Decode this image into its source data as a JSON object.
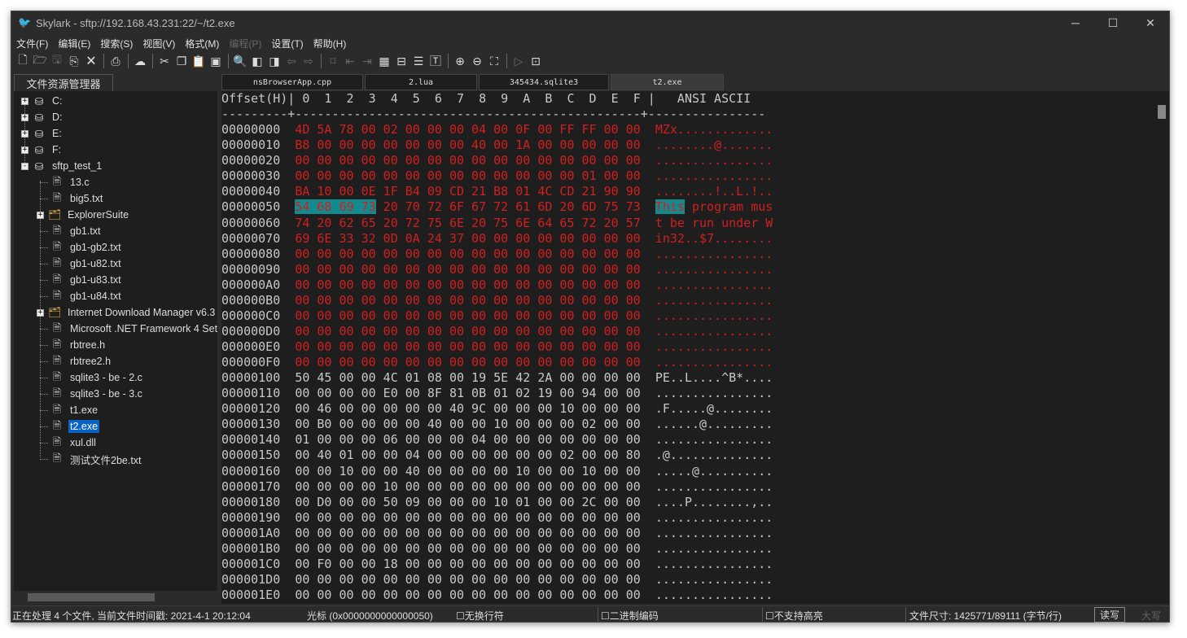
{
  "window": {
    "title": "Skylark - sftp://192.168.43.231:22/~/t2.exe",
    "minimize": "─",
    "maximize": "☐",
    "close": "✕"
  },
  "menu": [
    {
      "label": "文件(F)",
      "enabled": true
    },
    {
      "label": "编辑(E)",
      "enabled": true
    },
    {
      "label": "搜索(S)",
      "enabled": true
    },
    {
      "label": "视图(V)",
      "enabled": true
    },
    {
      "label": "格式(M)",
      "enabled": true
    },
    {
      "label": "编程(P)",
      "enabled": false
    },
    {
      "label": "设置(T)",
      "enabled": true
    },
    {
      "label": "帮助(H)",
      "enabled": true
    }
  ],
  "toolbar": [
    {
      "icon": "new-file-icon",
      "glyph": "🗋",
      "enabled": true
    },
    {
      "icon": "open-folder-icon",
      "glyph": "🗁",
      "enabled": true
    },
    {
      "icon": "save-icon",
      "glyph": "🖫",
      "enabled": false
    },
    {
      "icon": "save-all-icon",
      "glyph": "⎘",
      "enabled": true
    },
    {
      "icon": "close-file-icon",
      "glyph": "🗙",
      "enabled": true
    },
    {
      "sep": true
    },
    {
      "icon": "print-icon",
      "glyph": "⎙",
      "enabled": true
    },
    {
      "sep": true
    },
    {
      "icon": "remote-cloud-icon",
      "glyph": "☁",
      "enabled": true
    },
    {
      "sep": true
    },
    {
      "icon": "cut-icon",
      "glyph": "✂",
      "enabled": true
    },
    {
      "icon": "copy-icon",
      "glyph": "❐",
      "enabled": true
    },
    {
      "icon": "paste-icon",
      "glyph": "📋",
      "enabled": true
    },
    {
      "icon": "clipboard-icon",
      "glyph": "▣",
      "enabled": true
    },
    {
      "sep": true
    },
    {
      "icon": "search-icon",
      "glyph": "🔍",
      "enabled": true
    },
    {
      "icon": "find-prev-icon",
      "glyph": "◧",
      "enabled": true
    },
    {
      "icon": "find-next-icon",
      "glyph": "◨",
      "enabled": true
    },
    {
      "icon": "undo-icon",
      "glyph": "⇦",
      "enabled": false
    },
    {
      "icon": "redo-icon",
      "glyph": "⇨",
      "enabled": false
    },
    {
      "sep": true
    },
    {
      "icon": "bookmark-icon",
      "glyph": "⌑",
      "enabled": false
    },
    {
      "icon": "bookmark-prev-icon",
      "glyph": "⇤",
      "enabled": false
    },
    {
      "icon": "bookmark-next-icon",
      "glyph": "⇥",
      "enabled": false
    },
    {
      "icon": "hex-view-icon",
      "glyph": "▦",
      "enabled": true
    },
    {
      "icon": "word-wrap-icon",
      "glyph": "⊟",
      "enabled": true
    },
    {
      "icon": "indent-icon",
      "glyph": "☰",
      "enabled": true
    },
    {
      "icon": "text-icon",
      "glyph": "🅃",
      "enabled": true
    },
    {
      "sep": true
    },
    {
      "icon": "zoom-in-icon",
      "glyph": "⊕",
      "enabled": true
    },
    {
      "icon": "zoom-out-icon",
      "glyph": "⊖",
      "enabled": true
    },
    {
      "icon": "fullscreen-icon",
      "glyph": "⛶",
      "enabled": true
    },
    {
      "sep": true
    },
    {
      "icon": "run-icon",
      "glyph": "▷",
      "enabled": false
    },
    {
      "icon": "terminal-icon",
      "glyph": "⊡",
      "enabled": true
    }
  ],
  "sidebar": {
    "tab": "文件资源管理器",
    "items": [
      {
        "label": "C:",
        "level": 0,
        "type": "drive",
        "expander": "+"
      },
      {
        "label": "D:",
        "level": 0,
        "type": "drive",
        "expander": "+"
      },
      {
        "label": "E:",
        "level": 0,
        "type": "drive",
        "expander": "+"
      },
      {
        "label": "F:",
        "level": 0,
        "type": "drive",
        "expander": "+"
      },
      {
        "label": "sftp_test_1",
        "level": 0,
        "type": "drive",
        "expander": "-"
      },
      {
        "label": "13.c",
        "level": 1,
        "type": "file"
      },
      {
        "label": "big5.txt",
        "level": 1,
        "type": "file"
      },
      {
        "label": "ExplorerSuite",
        "level": 1,
        "type": "folder",
        "expander": "+"
      },
      {
        "label": "gb1.txt",
        "level": 1,
        "type": "file"
      },
      {
        "label": "gb1-gb2.txt",
        "level": 1,
        "type": "file"
      },
      {
        "label": "gb1-u82.txt",
        "level": 1,
        "type": "file"
      },
      {
        "label": "gb1-u83.txt",
        "level": 1,
        "type": "file"
      },
      {
        "label": "gb1-u84.txt",
        "level": 1,
        "type": "file"
      },
      {
        "label": "Internet Download Manager v6.3",
        "level": 1,
        "type": "folder",
        "expander": "+"
      },
      {
        "label": "Microsoft .NET Framework 4 Set",
        "level": 1,
        "type": "file"
      },
      {
        "label": "rbtree.h",
        "level": 1,
        "type": "file"
      },
      {
        "label": "rbtree2.h",
        "level": 1,
        "type": "file"
      },
      {
        "label": "sqlite3 - be - 2.c",
        "level": 1,
        "type": "file"
      },
      {
        "label": "sqlite3 - be - 3.c",
        "level": 1,
        "type": "file"
      },
      {
        "label": "t1.exe",
        "level": 1,
        "type": "file"
      },
      {
        "label": "t2.exe",
        "level": 1,
        "type": "file",
        "selected": true
      },
      {
        "label": "xul.dll",
        "level": 1,
        "type": "file"
      },
      {
        "label": "测试文件2be.txt",
        "level": 1,
        "type": "file"
      }
    ]
  },
  "tabs": [
    {
      "label": "nsBrowserApp.cpp",
      "active": false
    },
    {
      "label": "2.lua",
      "active": false
    },
    {
      "label": "345434.sqlite3",
      "active": false
    },
    {
      "label": "t2.exe",
      "active": true
    }
  ],
  "hex": {
    "header": "Offset(H)| 0  1  2  3  4  5  6  7  8  9  A  B  C  D  E  F |   ANSI ASCII",
    "divider": "---------+-----------------------------------------------+----------------",
    "colors": {
      "modified": "#d21f1f",
      "normal": "#c8c8c8",
      "selection": "#138a8e"
    },
    "selection": {
      "offset": "00000050",
      "start": 0,
      "length": 4
    },
    "rows": [
      {
        "offset": "00000000",
        "bytes": "4D 5A 78 00 02 00 00 00 04 00 0F 00 FF FF 00 00",
        "ascii": "MZx.............",
        "modified": true
      },
      {
        "offset": "00000010",
        "bytes": "B8 00 00 00 00 00 00 00 40 00 1A 00 00 00 00 00",
        "ascii": "........@.......",
        "modified": true
      },
      {
        "offset": "00000020",
        "bytes": "00 00 00 00 00 00 00 00 00 00 00 00 00 00 00 00",
        "ascii": "................",
        "modified": true
      },
      {
        "offset": "00000030",
        "bytes": "00 00 00 00 00 00 00 00 00 00 00 00 00 01 00 00",
        "ascii": "................",
        "modified": true
      },
      {
        "offset": "00000040",
        "bytes": "BA 10 00 0E 1F B4 09 CD 21 B8 01 4C CD 21 90 90",
        "ascii": "........!..L.!..",
        "modified": true
      },
      {
        "offset": "00000050",
        "bytes": "54 68 69 73 20 70 72 6F 67 72 61 6D 20 6D 75 73",
        "ascii": "This program mus",
        "modified": true
      },
      {
        "offset": "00000060",
        "bytes": "74 20 62 65 20 72 75 6E 20 75 6E 64 65 72 20 57",
        "ascii": "t be run under W",
        "modified": true
      },
      {
        "offset": "00000070",
        "bytes": "69 6E 33 32 0D 0A 24 37 00 00 00 00 00 00 00 00",
        "ascii": "in32..$7........",
        "modified": true
      },
      {
        "offset": "00000080",
        "bytes": "00 00 00 00 00 00 00 00 00 00 00 00 00 00 00 00",
        "ascii": "................",
        "modified": true
      },
      {
        "offset": "00000090",
        "bytes": "00 00 00 00 00 00 00 00 00 00 00 00 00 00 00 00",
        "ascii": "................",
        "modified": true
      },
      {
        "offset": "000000A0",
        "bytes": "00 00 00 00 00 00 00 00 00 00 00 00 00 00 00 00",
        "ascii": "................",
        "modified": true
      },
      {
        "offset": "000000B0",
        "bytes": "00 00 00 00 00 00 00 00 00 00 00 00 00 00 00 00",
        "ascii": "................",
        "modified": true
      },
      {
        "offset": "000000C0",
        "bytes": "00 00 00 00 00 00 00 00 00 00 00 00 00 00 00 00",
        "ascii": "................",
        "modified": true
      },
      {
        "offset": "000000D0",
        "bytes": "00 00 00 00 00 00 00 00 00 00 00 00 00 00 00 00",
        "ascii": "................",
        "modified": true
      },
      {
        "offset": "000000E0",
        "bytes": "00 00 00 00 00 00 00 00 00 00 00 00 00 00 00 00",
        "ascii": "................",
        "modified": true
      },
      {
        "offset": "000000F0",
        "bytes": "00 00 00 00 00 00 00 00 00 00 00 00 00 00 00 00",
        "ascii": "................",
        "modified": true
      },
      {
        "offset": "00000100",
        "bytes": "50 45 00 00 4C 01 08 00 19 5E 42 2A 00 00 00 00",
        "ascii": "PE..L....^B*....",
        "modified": false
      },
      {
        "offset": "00000110",
        "bytes": "00 00 00 00 E0 00 8F 81 0B 01 02 19 00 94 00 00",
        "ascii": "................",
        "modified": false
      },
      {
        "offset": "00000120",
        "bytes": "00 46 00 00 00 00 00 40 9C 00 00 00 10 00 00 00",
        "ascii": ".F.....@........",
        "modified": false
      },
      {
        "offset": "00000130",
        "bytes": "00 B0 00 00 00 00 40 00 00 10 00 00 00 02 00 00",
        "ascii": "......@.........",
        "modified": false
      },
      {
        "offset": "00000140",
        "bytes": "01 00 00 00 06 00 00 00 04 00 00 00 00 00 00 00",
        "ascii": "................",
        "modified": false
      },
      {
        "offset": "00000150",
        "bytes": "00 40 01 00 00 04 00 00 00 00 00 00 02 00 00 80",
        "ascii": ".@..............",
        "modified": false
      },
      {
        "offset": "00000160",
        "bytes": "00 00 10 00 00 40 00 00 00 00 10 00 00 10 00 00",
        "ascii": ".....@..........",
        "modified": false
      },
      {
        "offset": "00000170",
        "bytes": "00 00 00 00 10 00 00 00 00 00 00 00 00 00 00 00",
        "ascii": "................",
        "modified": false
      },
      {
        "offset": "00000180",
        "bytes": "00 D0 00 00 50 09 00 00 00 10 01 00 00 2C 00 00",
        "ascii": "....P........,..",
        "modified": false
      },
      {
        "offset": "00000190",
        "bytes": "00 00 00 00 00 00 00 00 00 00 00 00 00 00 00 00",
        "ascii": "................",
        "modified": false
      },
      {
        "offset": "000001A0",
        "bytes": "00 00 00 00 00 00 00 00 00 00 00 00 00 00 00 00",
        "ascii": "................",
        "modified": false
      },
      {
        "offset": "000001B0",
        "bytes": "00 00 00 00 00 00 00 00 00 00 00 00 00 00 00 00",
        "ascii": "................",
        "modified": false
      },
      {
        "offset": "000001C0",
        "bytes": "00 F0 00 00 18 00 00 00 00 00 00 00 00 00 00 00",
        "ascii": "................",
        "modified": false
      },
      {
        "offset": "000001D0",
        "bytes": "00 00 00 00 00 00 00 00 00 00 00 00 00 00 00 00",
        "ascii": "................",
        "modified": false
      },
      {
        "offset": "000001E0",
        "bytes": "00 00 00 00 00 00 00 00 00 00 00 00 00 00 00 00",
        "ascii": "................",
        "modified": false
      }
    ]
  },
  "status": {
    "files": "正在处理 4 个文件, 当前文件时间戳: 2021-4-1 20:12:04",
    "cursor": "光标 (0x0000000000000050)",
    "line_ending": "☐无换行符",
    "encoding": "☐二进制编码",
    "highlight": "☐不支持高亮",
    "file_size": "文件尺寸: 1425771/89111 (字节/行)",
    "mode": "读写",
    "caps": "大写"
  }
}
